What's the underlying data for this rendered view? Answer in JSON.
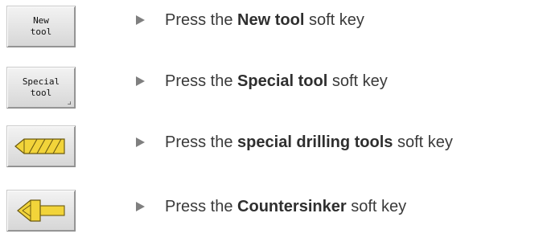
{
  "steps": [
    {
      "softkey_lines": [
        "New",
        "tool"
      ],
      "prefix": "Press the ",
      "keyword": "New tool",
      "suffix": " soft key"
    },
    {
      "softkey_lines": [
        "Special",
        "tool"
      ],
      "prefix": "Press the ",
      "keyword": "Special tool",
      "suffix": " soft key"
    },
    {
      "softkey_icon": "drill-icon",
      "prefix": "Press the ",
      "keyword": "special drilling tools",
      "suffix": " soft key"
    },
    {
      "softkey_icon": "countersinker-icon",
      "prefix": "Press the ",
      "keyword": "Countersinker",
      "suffix": " soft key"
    }
  ],
  "colors": {
    "tool_yellow": "#f2d43a",
    "bullet_gray": "#7f7f7f"
  }
}
